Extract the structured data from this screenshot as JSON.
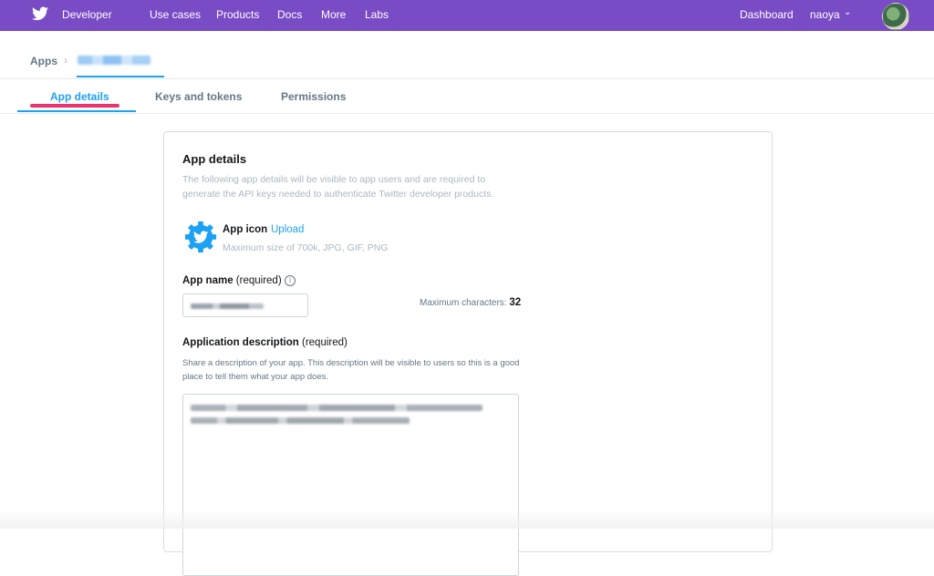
{
  "topbar": {
    "brand": "Developer",
    "nav": [
      "Use cases",
      "Products",
      "Docs",
      "More",
      "Labs"
    ],
    "dashboard": "Dashboard",
    "username": "naoya",
    "accent_color": "#794bc4"
  },
  "breadcrumb": {
    "root": "Apps"
  },
  "tabs": {
    "items": [
      "App details",
      "Keys and tokens",
      "Permissions"
    ],
    "active": "App details",
    "active_color": "#1da1f2"
  },
  "card": {
    "title": "App details",
    "description": "The following app details will be visible to app users and are required to generate the API keys needed to authenticate Twitter developer products.",
    "app_icon": {
      "label": "App icon",
      "upload": "Upload",
      "hint": "Maximum size of 700k, JPG, GIF, PNG"
    },
    "app_name": {
      "label": "App name",
      "suffix": "(required)",
      "max_label": "Maximum characters:",
      "max_value": "32"
    },
    "app_description": {
      "label": "Application description",
      "suffix": "(required)",
      "help": "Share a description of your app. This description will be visible to users so this is a good place to tell them what your app does."
    }
  }
}
